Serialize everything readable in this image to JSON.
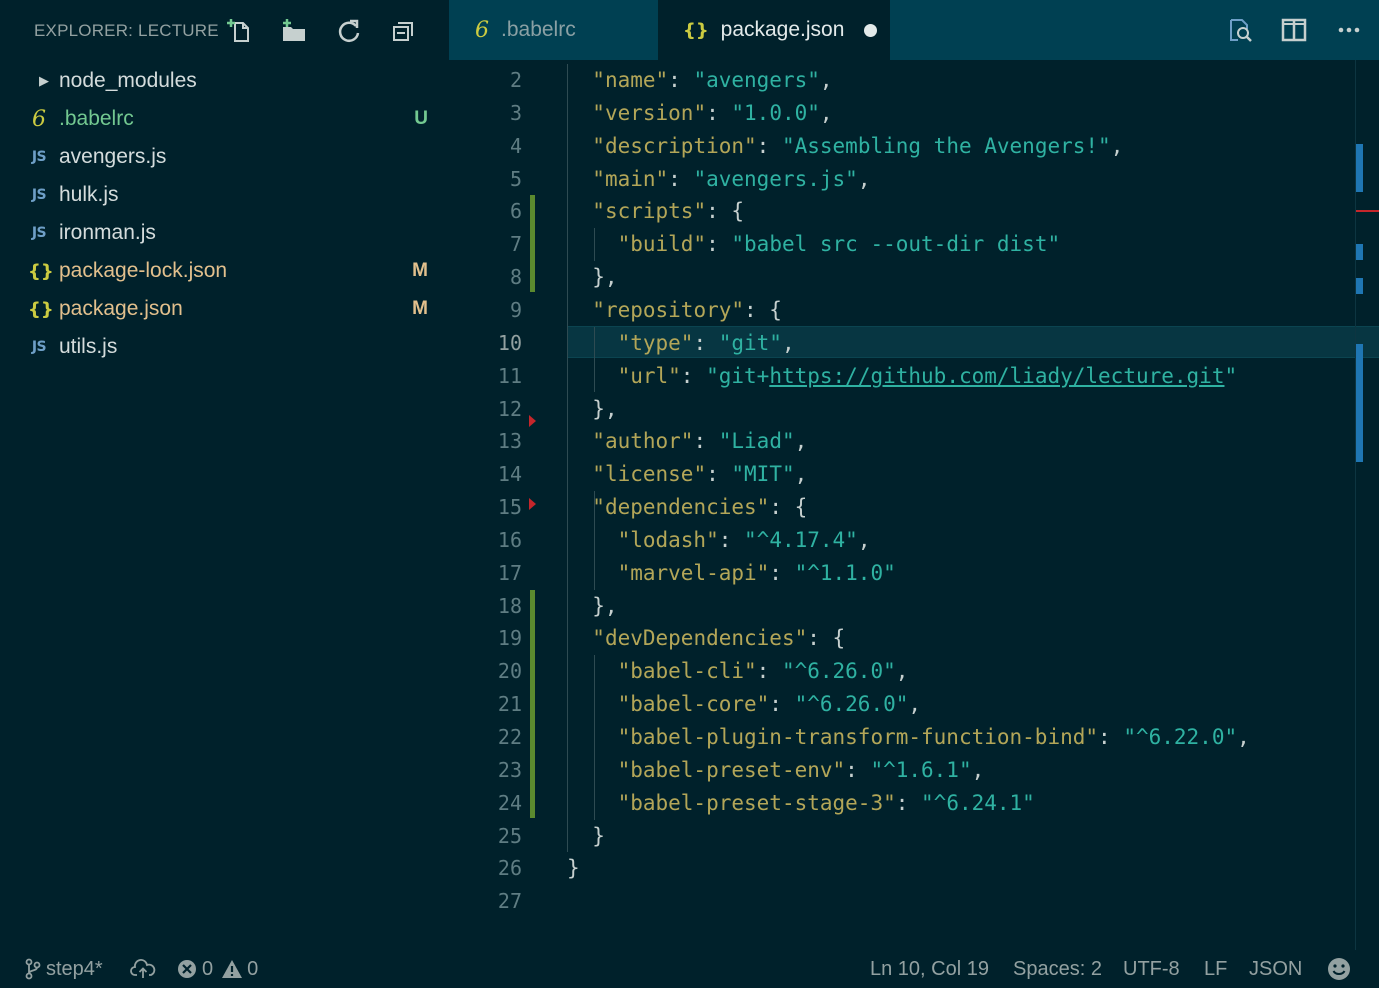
{
  "sidebar": {
    "title": "EXPLORER: LECTURE",
    "header_icons": [
      "new-file-icon",
      "new-folder-icon",
      "refresh-icon",
      "collapse-all-icon"
    ],
    "files": [
      {
        "icon": "",
        "name": "node_modules",
        "status": "",
        "kind": "folder"
      },
      {
        "icon": "6",
        "name": ".babelrc",
        "status": "U",
        "kind": "babel"
      },
      {
        "icon": "JS",
        "name": "avengers.js",
        "status": "",
        "kind": "js"
      },
      {
        "icon": "JS",
        "name": "hulk.js",
        "status": "",
        "kind": "js"
      },
      {
        "icon": "JS",
        "name": "ironman.js",
        "status": "",
        "kind": "js"
      },
      {
        "icon": "{}",
        "name": "package-lock.json",
        "status": "M",
        "kind": "json"
      },
      {
        "icon": "{}",
        "name": "package.json",
        "status": "M",
        "kind": "json"
      },
      {
        "icon": "JS",
        "name": "utils.js",
        "status": "",
        "kind": "js"
      }
    ]
  },
  "tabs": [
    {
      "icon": "6",
      "label": ".babelrc",
      "active": false
    },
    {
      "icon": "{}",
      "label": "package.json",
      "active": true,
      "dirty": true
    }
  ],
  "tab_actions": [
    "open-preview-icon",
    "split-editor-icon",
    "more-actions-icon"
  ],
  "editor": {
    "first_line_number": 2,
    "current_line": 10,
    "lines": [
      [
        [
          "p",
          "  "
        ],
        [
          "k",
          "\"name\""
        ],
        [
          "p",
          ": "
        ],
        [
          "s",
          "\"avengers\""
        ],
        [
          "p",
          ","
        ]
      ],
      [
        [
          "p",
          "  "
        ],
        [
          "k",
          "\"version\""
        ],
        [
          "p",
          ": "
        ],
        [
          "s",
          "\"1.0.0\""
        ],
        [
          "p",
          ","
        ]
      ],
      [
        [
          "p",
          "  "
        ],
        [
          "k",
          "\"description\""
        ],
        [
          "p",
          ": "
        ],
        [
          "s",
          "\"Assembling the Avengers!\""
        ],
        [
          "p",
          ","
        ]
      ],
      [
        [
          "p",
          "  "
        ],
        [
          "k",
          "\"main\""
        ],
        [
          "p",
          ": "
        ],
        [
          "s",
          "\"avengers.js\""
        ],
        [
          "p",
          ","
        ]
      ],
      [
        [
          "p",
          "  "
        ],
        [
          "k",
          "\"scripts\""
        ],
        [
          "p",
          ": {"
        ]
      ],
      [
        [
          "p",
          "    "
        ],
        [
          "k",
          "\"build\""
        ],
        [
          "p",
          ": "
        ],
        [
          "s",
          "\"babel src --out-dir dist\""
        ]
      ],
      [
        [
          "p",
          "  },"
        ]
      ],
      [
        [
          "p",
          "  "
        ],
        [
          "k",
          "\"repository\""
        ],
        [
          "p",
          ": {"
        ]
      ],
      [
        [
          "p",
          "    "
        ],
        [
          "k",
          "\"type\""
        ],
        [
          "p",
          ": "
        ],
        [
          "s",
          "\"git\""
        ],
        [
          "p",
          ","
        ]
      ],
      [
        [
          "p",
          "    "
        ],
        [
          "k",
          "\"url\""
        ],
        [
          "p",
          ": "
        ],
        [
          "s",
          "\"git+"
        ],
        [
          "sl",
          "https://github.com/liady/lecture.git"
        ],
        [
          "s",
          "\""
        ]
      ],
      [
        [
          "p",
          "  },"
        ]
      ],
      [
        [
          "p",
          "  "
        ],
        [
          "k",
          "\"author\""
        ],
        [
          "p",
          ": "
        ],
        [
          "s",
          "\"Liad\""
        ],
        [
          "p",
          ","
        ]
      ],
      [
        [
          "p",
          "  "
        ],
        [
          "k",
          "\"license\""
        ],
        [
          "p",
          ": "
        ],
        [
          "s",
          "\"MIT\""
        ],
        [
          "p",
          ","
        ]
      ],
      [
        [
          "p",
          "  "
        ],
        [
          "k",
          "\"dependencies\""
        ],
        [
          "p",
          ": {"
        ]
      ],
      [
        [
          "p",
          "    "
        ],
        [
          "k",
          "\"lodash\""
        ],
        [
          "p",
          ": "
        ],
        [
          "s",
          "\"^4.17.4\""
        ],
        [
          "p",
          ","
        ]
      ],
      [
        [
          "p",
          "    "
        ],
        [
          "k",
          "\"marvel-api\""
        ],
        [
          "p",
          ": "
        ],
        [
          "s",
          "\"^1.1.0\""
        ]
      ],
      [
        [
          "p",
          "  },"
        ]
      ],
      [
        [
          "p",
          "  "
        ],
        [
          "k",
          "\"devDependencies\""
        ],
        [
          "p",
          ": {"
        ]
      ],
      [
        [
          "p",
          "    "
        ],
        [
          "k",
          "\"babel-cli\""
        ],
        [
          "p",
          ": "
        ],
        [
          "s",
          "\"^6.26.0\""
        ],
        [
          "p",
          ","
        ]
      ],
      [
        [
          "p",
          "    "
        ],
        [
          "k",
          "\"babel-core\""
        ],
        [
          "p",
          ": "
        ],
        [
          "s",
          "\"^6.26.0\""
        ],
        [
          "p",
          ","
        ]
      ],
      [
        [
          "p",
          "    "
        ],
        [
          "k",
          "\"babel-plugin-transform-function-bind\""
        ],
        [
          "p",
          ": "
        ],
        [
          "s",
          "\"^6.22.0\""
        ],
        [
          "p",
          ","
        ]
      ],
      [
        [
          "p",
          "    "
        ],
        [
          "k",
          "\"babel-preset-env\""
        ],
        [
          "p",
          ": "
        ],
        [
          "s",
          "\"^1.6.1\""
        ],
        [
          "p",
          ","
        ]
      ],
      [
        [
          "p",
          "    "
        ],
        [
          "k",
          "\"babel-preset-stage-3\""
        ],
        [
          "p",
          ": "
        ],
        [
          "s",
          "\"^6.24.1\""
        ]
      ],
      [
        [
          "p",
          "  }"
        ]
      ],
      [
        [
          "p",
          "}"
        ]
      ],
      [
        [
          "p",
          ""
        ]
      ]
    ]
  },
  "statusbar": {
    "branch": "step4*",
    "errors": "0",
    "warnings": "0",
    "cursor": "Ln 10, Col 19",
    "spaces": "Spaces: 2",
    "encoding": "UTF-8",
    "eol": "LF",
    "language": "JSON"
  },
  "colors": {
    "background": "#00212b",
    "tab_inactive": "#004052",
    "key": "#b3a658",
    "string": "#2fb2a2",
    "untracked": "#73c991",
    "modified": "#e2c08d"
  }
}
